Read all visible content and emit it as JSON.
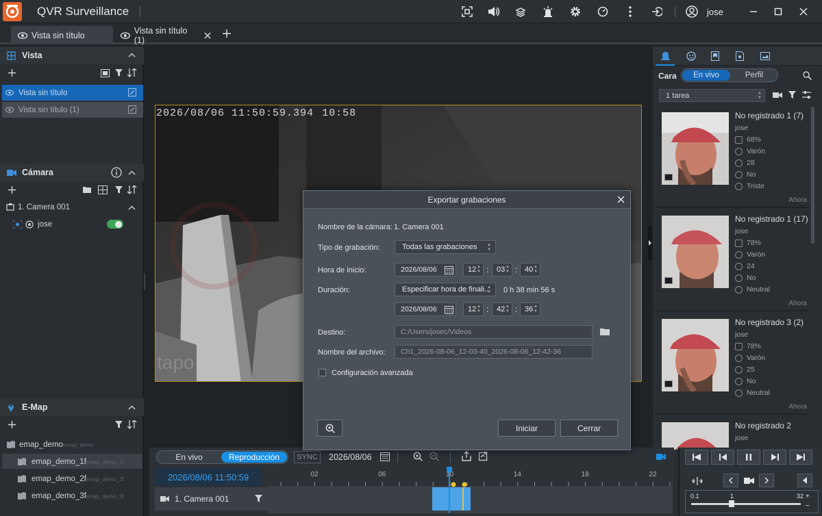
{
  "app": {
    "title": "QVR Surveillance",
    "user": "jose"
  },
  "tabs": [
    {
      "label": "Vista sin título"
    },
    {
      "label": "Vista sin título (1)"
    }
  ],
  "left": {
    "vista": {
      "header": "Vista",
      "items": [
        {
          "label": "Vista sin título"
        },
        {
          "label": "Vista sin título (1)"
        }
      ]
    },
    "camara": {
      "header": "Cámara",
      "camera": "1. Camera 001",
      "user": "jose"
    },
    "emap": {
      "header": "E-Map",
      "items": [
        {
          "label": "emap_demo",
          "sub": "emap_demo"
        },
        {
          "label": "emap_demo_1f",
          "sub": "emap_demo_1f"
        },
        {
          "label": "emap_demo_2f",
          "sub": "emap_demo_2f"
        },
        {
          "label": "emap_demo_3f",
          "sub": "emap_demo_3f"
        }
      ]
    }
  },
  "video": {
    "osd": "2026/08/06 11:50:59.394",
    "osd_overlay": "10:58",
    "watermark": "tapo"
  },
  "dialog": {
    "title": "Exportar grabaciones",
    "camera_label": "Nombre de la cámara:",
    "camera_value": "1. Camera 001",
    "type_label": "Tipo de grabación:",
    "type_value": "Todas las grabaciones",
    "start_label": "Hora de inicio:",
    "start_date": "2026/08/06",
    "start_h": "12",
    "start_m": "03",
    "start_s": "40",
    "duration_label": "Duración:",
    "duration_value": "Especificar hora de finali...",
    "duration_text": "0 h 38 min 56 s",
    "end_date": "2026/08/06",
    "end_h": "12",
    "end_m": "42",
    "end_s": "36",
    "dest_label": "Destino:",
    "dest_value": "C:/Users/josec/Videos",
    "file_label": "Nombre del archivo:",
    "file_value": "Ch1_2026-08-06_12-03-40_2026-08-06_12-42-36",
    "advanced_label": "Configuración avanzada",
    "start_button": "Iniciar",
    "close_button": "Cerrar"
  },
  "right": {
    "cara_label": "Cara",
    "toggle_live": "En vivo",
    "toggle_profile": "Perfil",
    "task_select": "1 tarea",
    "cards": [
      {
        "title": "No registrado 1 (7)",
        "user": "jose",
        "conf": "68%",
        "gender": "Varón",
        "age": "28",
        "mask": "No",
        "emotion": "Triste",
        "time": "Ahora"
      },
      {
        "title": "No registrado 1 (17)",
        "user": "jose",
        "conf": "78%",
        "gender": "Varón",
        "age": "24",
        "mask": "No",
        "emotion": "Neutral",
        "time": "Ahora"
      },
      {
        "title": "No registrado 3 (2)",
        "user": "jose",
        "conf": "78%",
        "gender": "Varón",
        "age": "25",
        "mask": "No",
        "emotion": "Neutral",
        "time": "Ahora"
      },
      {
        "title": "No registrado 2",
        "user": "jose"
      }
    ]
  },
  "timeline": {
    "live_label": "En vivo",
    "playback_label": "Reproducción",
    "sync_label": "SYNC",
    "date": "2026/08/06",
    "current_time": "2026/08/06 11:50:59",
    "camera": "1. Camera 001",
    "hours": [
      "02",
      "06",
      "10",
      "14",
      "18",
      "22"
    ],
    "speed_min": "0.1",
    "speed_mid": "1",
    "speed_max": "32"
  },
  "colors": {
    "accent": "#1a8fe3",
    "selected_row": "#1767b8",
    "video_border": "#b68b20",
    "logo": "#e8652b"
  }
}
